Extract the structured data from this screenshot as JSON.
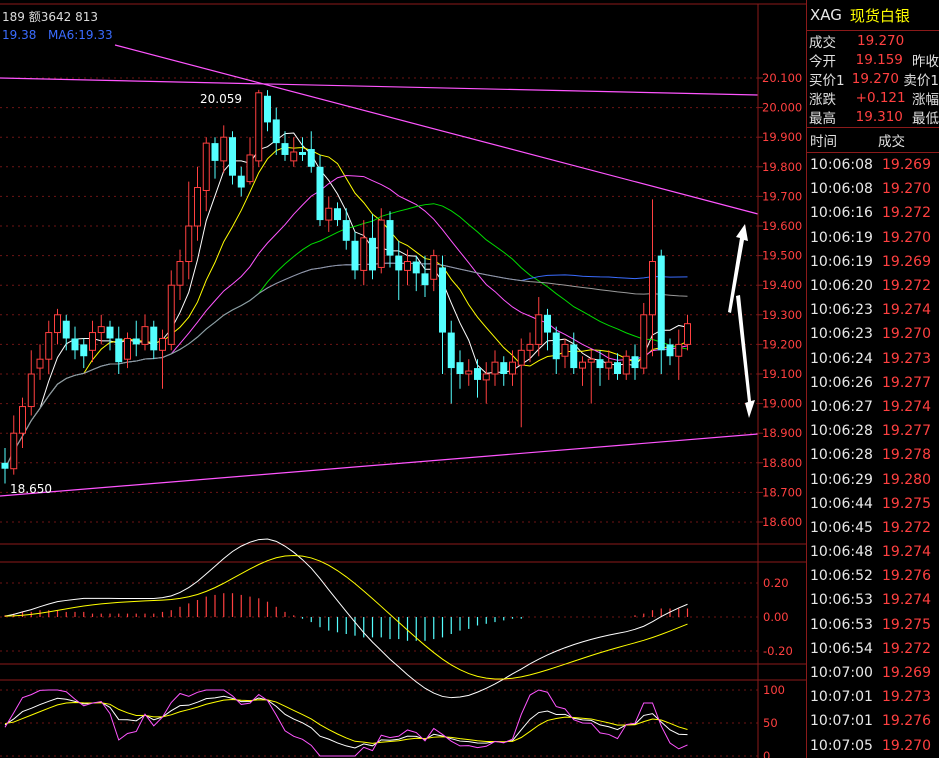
{
  "top_info": {
    "text": "189 额3642 813"
  },
  "ma_legend": {
    "ma_a": "19.38",
    "ma_b": "MA6:19.33"
  },
  "price_axis": [
    "20.100",
    "20.000",
    "19.900",
    "19.800",
    "19.700",
    "19.600",
    "19.500",
    "19.400",
    "19.300",
    "19.200",
    "19.100",
    "19.000",
    "18.900",
    "18.800",
    "18.700",
    "18.600"
  ],
  "annotations": {
    "high": "20.059",
    "low": "18.650"
  },
  "macd_axis": [
    "0.20",
    "0.00",
    "-0.20"
  ],
  "kdj_axis": [
    "100",
    "50",
    "0"
  ],
  "header": {
    "code": "XAG",
    "name": "现货白银"
  },
  "quote": {
    "rows": [
      {
        "label": "成交",
        "value": "19.270",
        "label2": ""
      },
      {
        "label": "今开",
        "value": "19.159",
        "label2": "昨收"
      },
      {
        "label": "买价1",
        "value": "19.270",
        "label2": "卖价1"
      },
      {
        "label": "涨跌",
        "value": "+0.121",
        "label2": "涨幅"
      },
      {
        "label": "最高",
        "value": "19.310",
        "label2": "最低"
      }
    ]
  },
  "ticks": {
    "header_time": "时间",
    "header_price": "成交",
    "rows": [
      {
        "time": "10:06:08",
        "price": "19.269"
      },
      {
        "time": "10:06:08",
        "price": "19.270"
      },
      {
        "time": "10:06:16",
        "price": "19.272"
      },
      {
        "time": "10:06:19",
        "price": "19.270"
      },
      {
        "time": "10:06:19",
        "price": "19.269"
      },
      {
        "time": "10:06:20",
        "price": "19.272"
      },
      {
        "time": "10:06:23",
        "price": "19.274"
      },
      {
        "time": "10:06:23",
        "price": "19.270"
      },
      {
        "time": "10:06:24",
        "price": "19.273"
      },
      {
        "time": "10:06:26",
        "price": "19.277"
      },
      {
        "time": "10:06:27",
        "price": "19.274"
      },
      {
        "time": "10:06:28",
        "price": "19.277"
      },
      {
        "time": "10:06:28",
        "price": "19.278"
      },
      {
        "time": "10:06:29",
        "price": "19.280"
      },
      {
        "time": "10:06:44",
        "price": "19.275"
      },
      {
        "time": "10:06:45",
        "price": "19.272"
      },
      {
        "time": "10:06:48",
        "price": "19.274"
      },
      {
        "time": "10:06:52",
        "price": "19.276"
      },
      {
        "time": "10:06:53",
        "price": "19.274"
      },
      {
        "time": "10:06:53",
        "price": "19.275"
      },
      {
        "time": "10:06:54",
        "price": "19.272"
      },
      {
        "time": "10:07:00",
        "price": "19.269"
      },
      {
        "time": "10:07:01",
        "price": "19.273"
      },
      {
        "time": "10:07:01",
        "price": "19.276"
      },
      {
        "time": "10:07:05",
        "price": "19.270"
      }
    ]
  },
  "colors": {
    "up": "#ff4040",
    "down": "#54ffff",
    "border": "#8b1a1a",
    "trend": "#ff55ff"
  },
  "chart_data": {
    "type": "candlestick",
    "ylim": [
      18.55,
      20.15
    ],
    "candles": [
      [
        18.8,
        18.78,
        18.85,
        18.73
      ],
      [
        18.78,
        18.9,
        18.96,
        18.76
      ],
      [
        18.9,
        18.99,
        19.02,
        18.85
      ],
      [
        18.99,
        19.1,
        19.18,
        18.96
      ],
      [
        19.12,
        19.15,
        19.2,
        19.08
      ],
      [
        19.15,
        19.24,
        19.28,
        19.1
      ],
      [
        19.24,
        19.3,
        19.32,
        19.2
      ],
      [
        19.28,
        19.22,
        19.3,
        19.18
      ],
      [
        19.22,
        19.18,
        19.26,
        19.15
      ],
      [
        19.2,
        19.16,
        19.22,
        19.12
      ],
      [
        19.18,
        19.24,
        19.28,
        19.14
      ],
      [
        19.24,
        19.26,
        19.3,
        19.2
      ],
      [
        19.26,
        19.22,
        19.28,
        19.18
      ],
      [
        19.22,
        19.14,
        19.26,
        19.1
      ],
      [
        19.15,
        19.22,
        19.24,
        19.12
      ],
      [
        19.22,
        19.2,
        19.28,
        19.16
      ],
      [
        19.2,
        19.26,
        19.3,
        19.18
      ],
      [
        19.26,
        19.18,
        19.28,
        19.15
      ],
      [
        19.18,
        19.22,
        19.25,
        19.05
      ],
      [
        19.2,
        19.4,
        19.45,
        19.18
      ],
      [
        19.4,
        19.48,
        19.52,
        19.35
      ],
      [
        19.48,
        19.6,
        19.75,
        19.42
      ],
      [
        19.6,
        19.73,
        19.8,
        19.55
      ],
      [
        19.72,
        19.88,
        19.9,
        19.65
      ],
      [
        19.88,
        19.82,
        19.9,
        19.76
      ],
      [
        19.82,
        19.9,
        19.94,
        19.78
      ],
      [
        19.9,
        19.77,
        19.92,
        19.74
      ],
      [
        19.77,
        19.73,
        19.8,
        19.7
      ],
      [
        19.75,
        19.84,
        19.9,
        19.74
      ],
      [
        19.82,
        20.05,
        20.06,
        19.8
      ],
      [
        20.04,
        19.95,
        20.059,
        19.92
      ],
      [
        19.96,
        19.88,
        20.0,
        19.84
      ],
      [
        19.88,
        19.84,
        19.92,
        19.82
      ],
      [
        19.82,
        19.85,
        19.9,
        19.8
      ],
      [
        19.85,
        19.84,
        19.9,
        19.82
      ],
      [
        19.86,
        19.8,
        19.92,
        19.78
      ],
      [
        19.8,
        19.62,
        19.84,
        19.6
      ],
      [
        19.62,
        19.66,
        19.7,
        19.58
      ],
      [
        19.66,
        19.62,
        19.68,
        19.6
      ],
      [
        19.62,
        19.55,
        19.66,
        19.52
      ],
      [
        19.55,
        19.45,
        19.58,
        19.42
      ],
      [
        19.45,
        19.56,
        19.62,
        19.4
      ],
      [
        19.56,
        19.45,
        19.64,
        19.42
      ],
      [
        19.46,
        19.62,
        19.66,
        19.44
      ],
      [
        19.62,
        19.5,
        19.65,
        19.46
      ],
      [
        19.5,
        19.45,
        19.55,
        19.35
      ],
      [
        19.45,
        19.48,
        19.52,
        19.4
      ],
      [
        19.48,
        19.44,
        19.5,
        19.38
      ],
      [
        19.44,
        19.4,
        19.5,
        19.36
      ],
      [
        19.42,
        19.5,
        19.52,
        19.38
      ],
      [
        19.46,
        19.24,
        19.5,
        19.1
      ],
      [
        19.24,
        19.12,
        19.28,
        19.0
      ],
      [
        19.14,
        19.1,
        19.18,
        19.05
      ],
      [
        19.1,
        19.11,
        19.15,
        19.06
      ],
      [
        19.12,
        19.08,
        19.15,
        19.02
      ],
      [
        19.08,
        19.1,
        19.14,
        19.0
      ],
      [
        19.1,
        19.14,
        19.18,
        19.06
      ],
      [
        19.14,
        19.1,
        19.16,
        19.06
      ],
      [
        19.1,
        19.14,
        19.18,
        19.06
      ],
      [
        19.13,
        19.18,
        19.22,
        18.92
      ],
      [
        19.18,
        19.2,
        19.24,
        19.14
      ],
      [
        19.2,
        19.3,
        19.36,
        19.16
      ],
      [
        19.3,
        19.24,
        19.32,
        19.18
      ],
      [
        19.24,
        19.15,
        19.26,
        19.1
      ],
      [
        19.16,
        19.2,
        19.22,
        19.12
      ],
      [
        19.2,
        19.12,
        19.24,
        19.1
      ],
      [
        19.12,
        19.14,
        19.16,
        19.06
      ],
      [
        19.14,
        19.15,
        19.18,
        19.0
      ],
      [
        19.15,
        19.12,
        19.18,
        19.06
      ],
      [
        19.12,
        19.14,
        19.18,
        19.08
      ],
      [
        19.14,
        19.1,
        19.17,
        19.08
      ],
      [
        19.1,
        19.16,
        19.18,
        19.08
      ],
      [
        19.16,
        19.12,
        19.2,
        19.08
      ],
      [
        19.12,
        19.3,
        19.34,
        19.1
      ],
      [
        19.3,
        19.48,
        19.69,
        19.16
      ],
      [
        19.5,
        19.18,
        19.52,
        19.1
      ],
      [
        19.2,
        19.16,
        19.22,
        19.13
      ],
      [
        19.16,
        19.2,
        19.25,
        19.08
      ],
      [
        19.2,
        19.27,
        19.3,
        19.18
      ]
    ],
    "macd_hist": [
      0.01,
      0.02,
      0.03,
      0.03,
      0.04,
      0.04,
      0.04,
      0.03,
      0.03,
      0.03,
      0.02,
      0.02,
      0.02,
      0.02,
      0.02,
      0.02,
      0.02,
      0.02,
      0.03,
      0.04,
      0.06,
      0.08,
      0.1,
      0.12,
      0.13,
      0.14,
      0.14,
      0.13,
      0.12,
      0.11,
      0.09,
      0.06,
      0.03,
      0.01,
      -0.01,
      -0.03,
      -0.06,
      -0.08,
      -0.09,
      -0.1,
      -0.11,
      -0.12,
      -0.12,
      -0.12,
      -0.13,
      -0.13,
      -0.14,
      -0.14,
      -0.14,
      -0.13,
      -0.12,
      -0.1,
      -0.08,
      -0.07,
      -0.05,
      -0.04,
      -0.03,
      -0.02,
      -0.01,
      -0.01,
      0.0,
      0.0,
      0.0,
      0.0,
      0.0,
      0.0,
      0.0,
      0.0,
      0.0,
      0.0,
      0.0,
      0.0,
      0.01,
      0.02,
      0.04,
      0.05,
      0.05,
      0.05,
      0.05
    ]
  }
}
